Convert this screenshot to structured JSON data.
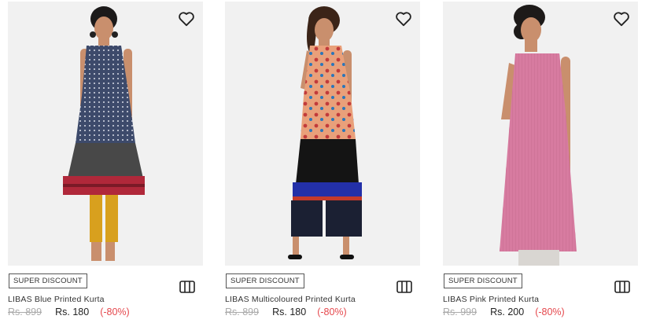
{
  "products": [
    {
      "badge": "SUPER DISCOUNT",
      "title": "LIBAS Blue Printed Kurta",
      "mrp": "Rs. 899",
      "price": "Rs. 180",
      "discount": "(-80%)"
    },
    {
      "badge": "SUPER DISCOUNT",
      "title": "LIBAS Multicoloured Printed Kurta",
      "mrp": "Rs. 899",
      "price": "Rs. 180",
      "discount": "(-80%)"
    },
    {
      "badge": "SUPER DISCOUNT",
      "title": "LIBAS Pink Printed Kurta",
      "mrp": "Rs. 999",
      "price": "Rs. 200",
      "discount": "(-80%)"
    }
  ],
  "icons": {
    "wishlist": "heart-outline-icon",
    "compare": "compare-icon"
  },
  "colors": {
    "discount": "#e5484d",
    "mrp": "#aaaaaa",
    "photo_bg": "#f1f1f1"
  }
}
